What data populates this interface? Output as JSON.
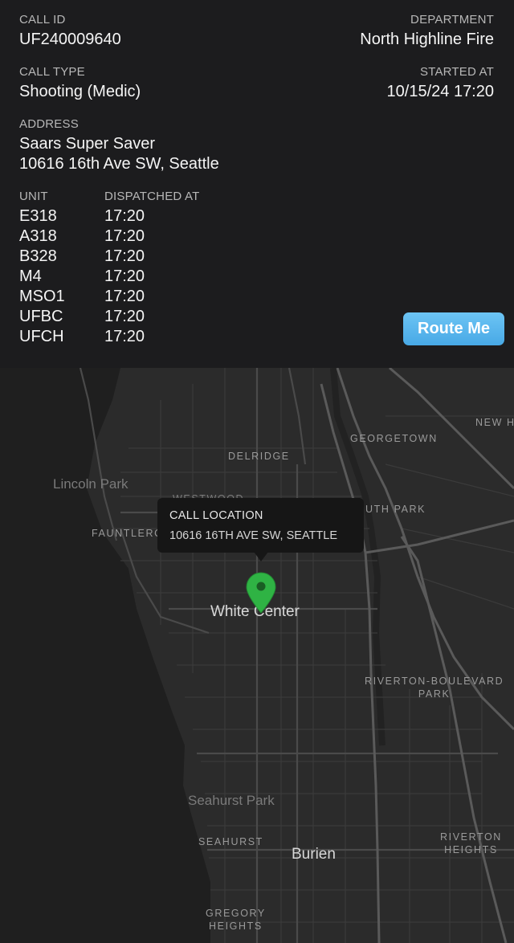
{
  "call": {
    "id_label": "CALL ID",
    "id_value": "UF240009640",
    "department_label": "DEPARTMENT",
    "department_value": "North Highline Fire",
    "type_label": "CALL TYPE",
    "type_value": "Shooting (Medic)",
    "started_label": "STARTED AT",
    "started_value": "10/15/24 17:20",
    "address_label": "ADDRESS",
    "address_line1": "Saars Super Saver",
    "address_line2": "10616 16th Ave SW, Seattle"
  },
  "units": {
    "unit_header": "UNIT",
    "dispatched_header": "DISPATCHED AT",
    "rows": [
      {
        "unit": "E318",
        "time": "17:20"
      },
      {
        "unit": "A318",
        "time": "17:20"
      },
      {
        "unit": "B328",
        "time": "17:20"
      },
      {
        "unit": "M4",
        "time": "17:20"
      },
      {
        "unit": "MSO1",
        "time": "17:20"
      },
      {
        "unit": "UFBC",
        "time": "17:20"
      },
      {
        "unit": "UFCH",
        "time": "17:20"
      }
    ]
  },
  "actions": {
    "route_label": "Route Me"
  },
  "map": {
    "labels": {
      "georgetown": "GEORGETOWN",
      "new_h": "NEW H",
      "delridge": "DELRIDGE",
      "lincoln_park": "Lincoln Park",
      "westwood": "WESTWOOD",
      "south_park": "UTH PARK",
      "fauntleroy": "FAUNTLERO",
      "white_center": "White Center",
      "riverton_boulevard_1": "RIVERTON-BOULEVARD",
      "riverton_boulevard_2": "PARK",
      "seahurst_park": "Seahurst Park",
      "seahurst": "SEAHURST",
      "burien": "Burien",
      "riverton_heights_1": "RIVERTON",
      "riverton_heights_2": "HEIGHTS",
      "gregory_heights_1": "GREGORY",
      "gregory_heights_2": "HEIGHTS"
    },
    "callout": {
      "title": "CALL LOCATION",
      "address": "10616 16TH AVE SW, SEATTLE"
    },
    "pin_color": "#2fb344",
    "water_color": "#1f1f1f",
    "land_color": "#2b2b2b"
  }
}
